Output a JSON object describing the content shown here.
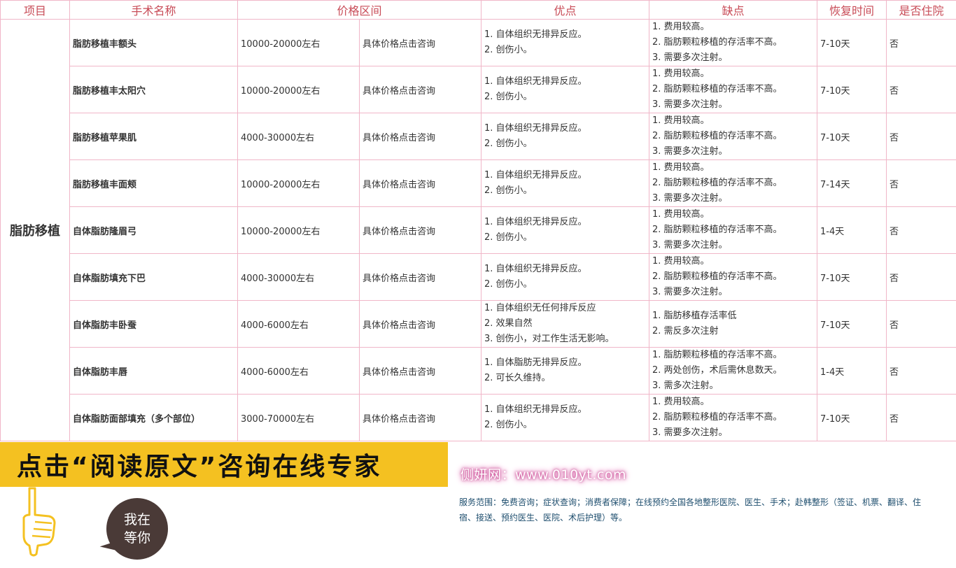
{
  "table": {
    "headers": [
      "项目",
      "手术名称",
      "价格区间",
      "优点",
      "缺点",
      "恢复时间",
      "是否住院"
    ],
    "category": "脂肪移植",
    "rows": [
      {
        "name": "脂肪移植丰额头",
        "price": "10000-20000左右",
        "link": "具体价格点击咨询",
        "pros": [
          "1. 自体组织无排异反应。",
          "2. 创伤小。"
        ],
        "cons": [
          "1. 费用较高。",
          "2. 脂肪颗粒移植的存活率不高。",
          "3. 需要多次注射。"
        ],
        "recovery": "7-10天",
        "hospital": "否"
      },
      {
        "name": "脂肪移植丰太阳穴",
        "price": "10000-20000左右",
        "link": "具体价格点击咨询",
        "pros": [
          "1. 自体组织无排异反应。",
          "2. 创伤小。"
        ],
        "cons": [
          "1. 费用较高。",
          "2. 脂肪颗粒移植的存活率不高。",
          "3. 需要多次注射。"
        ],
        "recovery": "7-10天",
        "hospital": "否"
      },
      {
        "name": "脂肪移植苹果肌",
        "price": "4000-30000左右",
        "link": "具体价格点击咨询",
        "pros": [
          "1. 自体组织无排异反应。",
          "2. 创伤小。"
        ],
        "cons": [
          "1. 费用较高。",
          "2. 脂肪颗粒移植的存活率不高。",
          "3. 需要多次注射。"
        ],
        "recovery": "7-10天",
        "hospital": "否"
      },
      {
        "name": "脂肪移植丰面颊",
        "price": "10000-20000左右",
        "link": "具体价格点击咨询",
        "pros": [
          "1. 自体组织无排异反应。",
          "2. 创伤小。"
        ],
        "cons": [
          "1. 费用较高。",
          "2. 脂肪颗粒移植的存活率不高。",
          "3. 需要多次注射。"
        ],
        "recovery": "7-14天",
        "hospital": "否"
      },
      {
        "name": "自体脂肪隆眉弓",
        "price": "10000-20000左右",
        "link": "具体价格点击咨询",
        "pros": [
          "1. 自体组织无排异反应。",
          "2. 创伤小。"
        ],
        "cons": [
          "1. 费用较高。",
          "2. 脂肪颗粒移植的存活率不高。",
          "3. 需要多次注射。"
        ],
        "recovery": "1-4天",
        "hospital": "否"
      },
      {
        "name": "自体脂肪填充下巴",
        "price": "4000-30000左右",
        "link": "具体价格点击咨询",
        "pros": [
          "1. 自体组织无排异反应。",
          "2. 创伤小。"
        ],
        "cons": [
          "1. 费用较高。",
          "2. 脂肪颗粒移植的存活率不高。",
          "3. 需要多次注射。"
        ],
        "recovery": "7-10天",
        "hospital": "否"
      },
      {
        "name": "自体脂肪丰卧蚕",
        "price": "4000-6000左右",
        "link": "具体价格点击咨询",
        "pros": [
          "1. 自体组织无任何排斥反应",
          "2. 效果自然",
          "3. 创伤小，对工作生活无影响。"
        ],
        "cons": [
          "1. 脂肪移植存活率低",
          "2. 需反多次注射"
        ],
        "recovery": "7-10天",
        "hospital": "否"
      },
      {
        "name": "自体脂肪丰唇",
        "price": "4000-6000左右",
        "link": "具体价格点击咨询",
        "pros": [
          "1. 自体脂肪无排异反应。",
          "2. 可长久维持。"
        ],
        "cons": [
          "1. 脂肪颗粒移植的存活率不高。",
          "2. 两处创伤，术后需休息数天。",
          "3. 需多次注射。"
        ],
        "recovery": "1-4天",
        "hospital": "否"
      },
      {
        "name": "自体脂肪面部填充（多个部位）",
        "price": "3000-70000左右",
        "link": "具体价格点击咨询",
        "pros": [
          "1. 自体组织无排异反应。",
          "2. 创伤小。"
        ],
        "cons": [
          "1. 费用较高。",
          "2. 脂肪颗粒移植的存活率不高。",
          "3. 需要多次注射。"
        ],
        "recovery": "7-10天",
        "hospital": "否"
      }
    ]
  },
  "banner": {
    "cta": "点击“阅读原文”咨询在线专家",
    "bubble_line1": "我在",
    "bubble_line2": "等你",
    "site": "侧妍网：www.010yt.com",
    "service": "服务范围：免费咨询；症状查询；消费者保障；在线预约全国各地整形医院、医生、手术；赴韩整形（签证、机票、翻译、住宿、接送、预约医生、医院、术后护理）等。"
  },
  "colors": {
    "border": "#f0b6c8",
    "header_text": "#c84b57",
    "link": "#1f6bb5",
    "banner_bg": "#f4c121"
  },
  "icons": [
    "pointing-hand-icon"
  ]
}
